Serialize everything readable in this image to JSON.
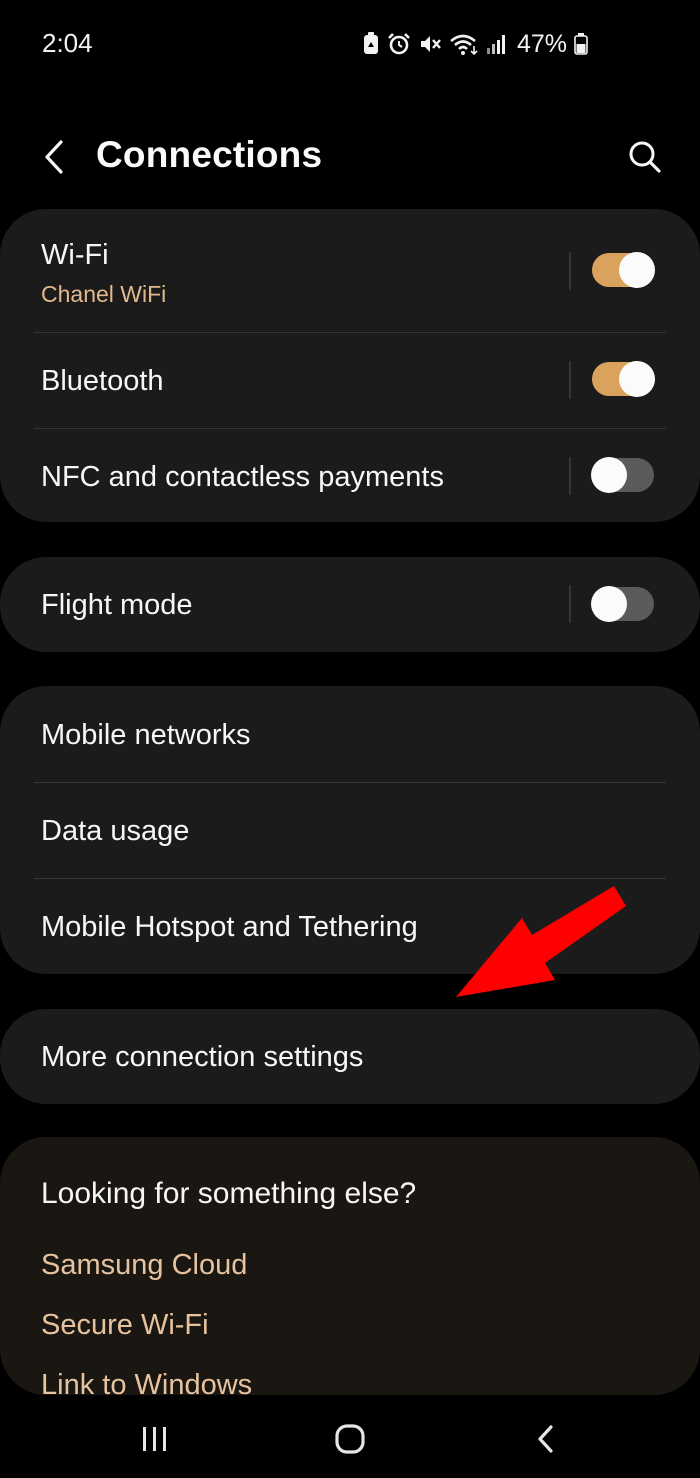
{
  "status_bar": {
    "time": "2:04",
    "battery": "47%",
    "icons": [
      "battery-saver-icon",
      "alarm-icon",
      "mute-icon",
      "wifi-icon",
      "signal-icon",
      "battery-icon"
    ]
  },
  "header": {
    "title": "Connections",
    "back_icon": "back-arrow-icon",
    "search_icon": "search-icon"
  },
  "group1": {
    "items": [
      {
        "label": "Wi-Fi",
        "sub": "Chanel WiFi",
        "toggle": true
      },
      {
        "label": "Bluetooth",
        "toggle": true
      },
      {
        "label": "NFC and contactless payments",
        "toggle": false
      }
    ]
  },
  "group2": {
    "items": [
      {
        "label": "Flight mode",
        "toggle": false
      }
    ]
  },
  "group3": {
    "items": [
      {
        "label": "Mobile networks"
      },
      {
        "label": "Data usage"
      },
      {
        "label": "Mobile Hotspot and Tethering"
      }
    ]
  },
  "group4": {
    "items": [
      {
        "label": "More connection settings"
      }
    ]
  },
  "suggestions": {
    "title": "Looking for something else?",
    "links": [
      "Samsung Cloud",
      "Secure Wi-Fi",
      "Link to Windows"
    ]
  },
  "nav_bar": {
    "icons": [
      "recent-apps-icon",
      "home-icon",
      "back-icon"
    ]
  },
  "colors": {
    "accent": "#d9a35e",
    "link": "#e6c39e",
    "card": "#1b1b1b",
    "annotation": "#ff0000"
  }
}
